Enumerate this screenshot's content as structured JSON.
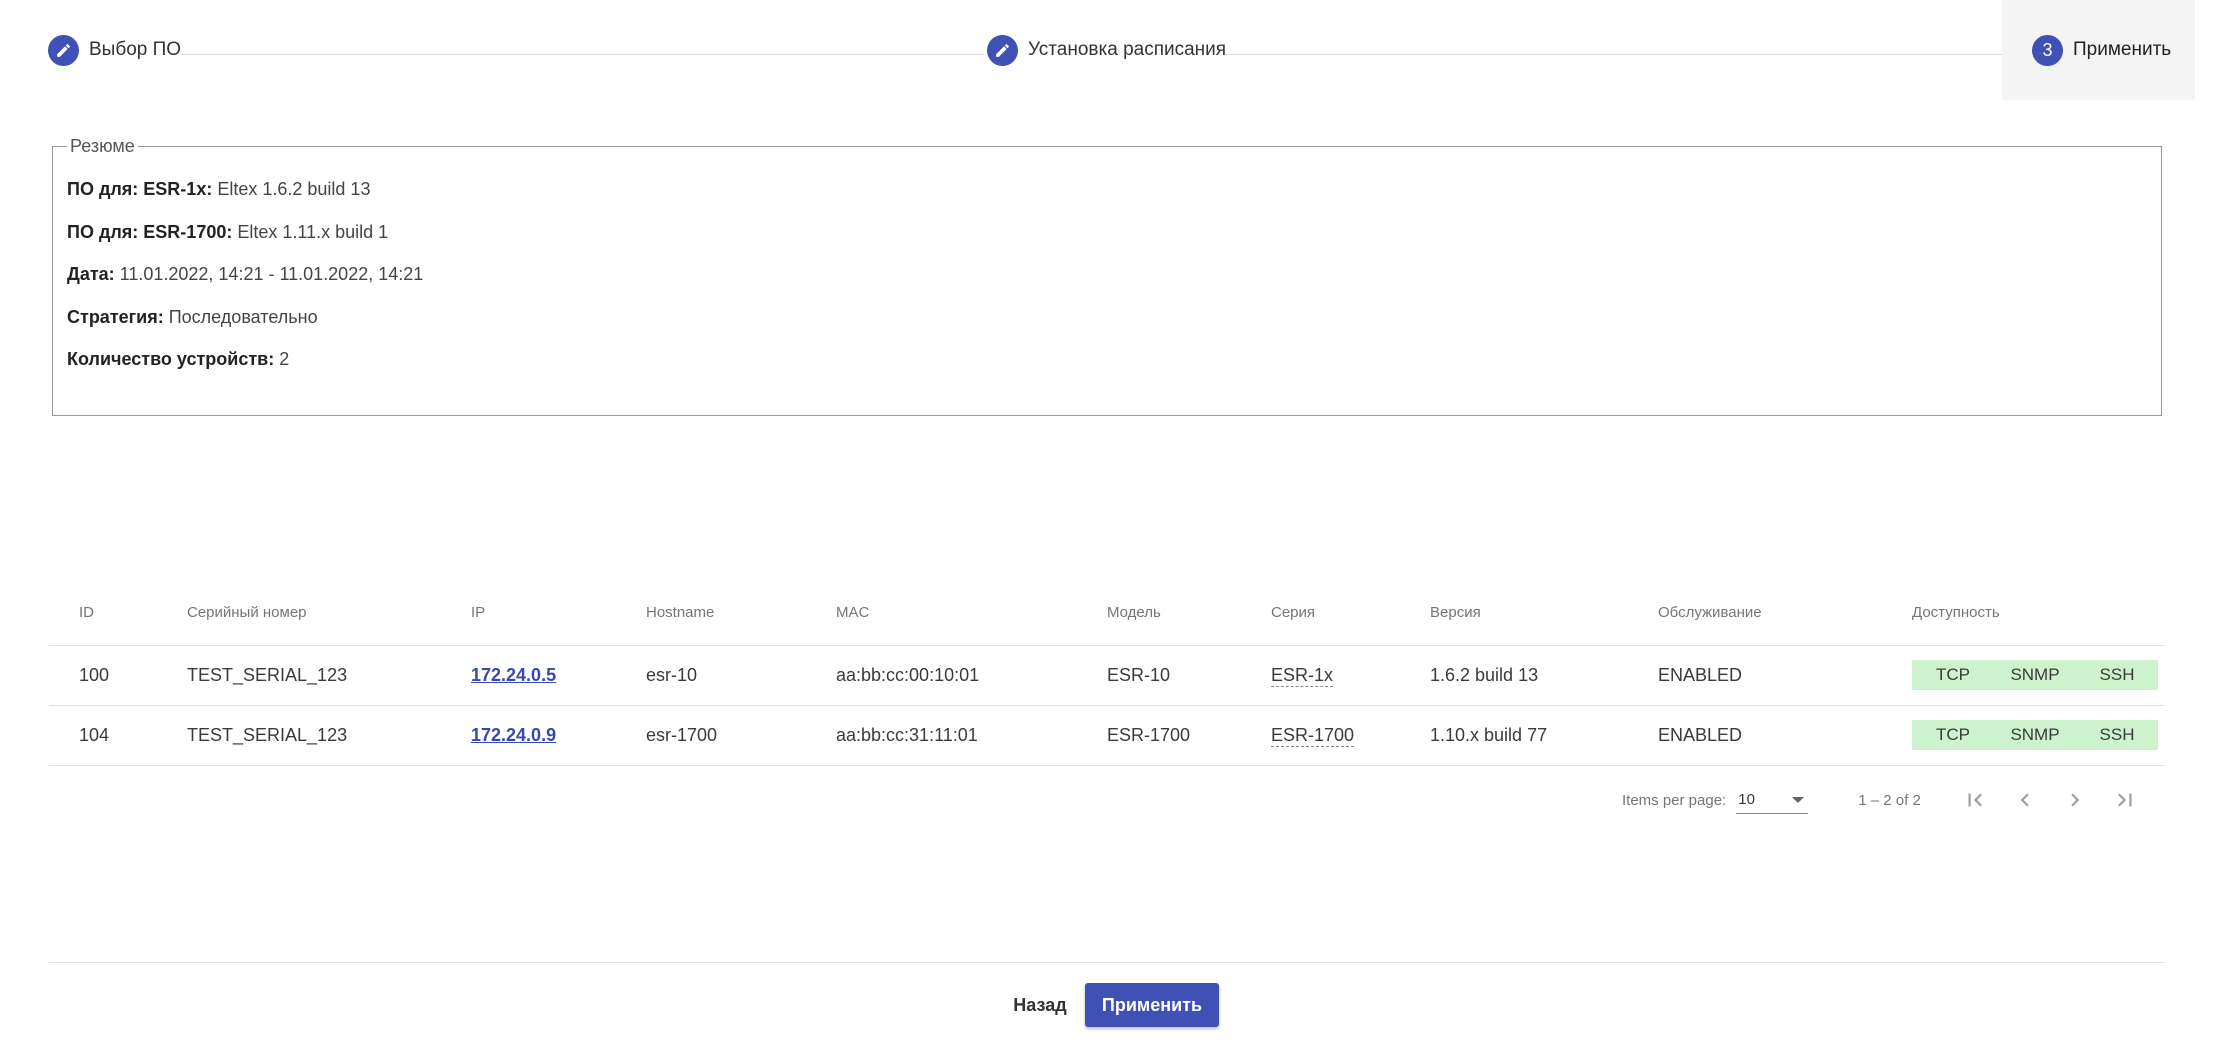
{
  "stepper": {
    "steps": [
      {
        "label": "Выбор ПО",
        "icon": "edit-icon"
      },
      {
        "label": "Установка расписания",
        "icon": "edit-icon"
      },
      {
        "label": "Применить",
        "number": "3"
      }
    ]
  },
  "summary": {
    "legend": "Резюме",
    "rows": [
      {
        "key": "ПО для: ESR-1x:",
        "value": "Eltex 1.6.2 build 13"
      },
      {
        "key": "ПО для: ESR-1700:",
        "value": "Eltex 1.11.x build 1"
      },
      {
        "key": "Дата:",
        "value": "11.01.2022, 14:21 - 11.01.2022, 14:21"
      },
      {
        "key": "Стратегия:",
        "value": "Последовательно"
      },
      {
        "key": "Количество устройств:",
        "value": "2"
      }
    ]
  },
  "table": {
    "columns": [
      "ID",
      "Серийный номер",
      "IP",
      "Hostname",
      "MAC",
      "Модель",
      "Серия",
      "Версия",
      "Обслуживание",
      "Доступность"
    ],
    "rows": [
      {
        "id": "100",
        "serial": "TEST_SERIAL_123",
        "ip": "172.24.0.5",
        "hostname": "esr-10",
        "mac": "aa:bb:cc:00:10:01",
        "model": "ESR-10",
        "series": "ESR-1x",
        "version": "1.6.2 build 13",
        "service": "ENABLED",
        "availability": [
          "TCP",
          "SNMP",
          "SSH"
        ]
      },
      {
        "id": "104",
        "serial": "TEST_SERIAL_123",
        "ip": "172.24.0.9",
        "hostname": "esr-1700",
        "mac": "aa:bb:cc:31:11:01",
        "model": "ESR-1700",
        "series": "ESR-1700",
        "version": "1.10.x build 77",
        "service": "ENABLED",
        "availability": [
          "TCP",
          "SNMP",
          "SSH"
        ]
      }
    ]
  },
  "paginator": {
    "items_per_page_label": "Items per page:",
    "items_per_page_value": "10",
    "range_label": "1 – 2 of 2"
  },
  "footer": {
    "back_label": "Назад",
    "apply_label": "Применить"
  },
  "colors": {
    "accent": "#3f51b5",
    "availability_ok": "#cdf3cd",
    "link": "#3949ab"
  }
}
